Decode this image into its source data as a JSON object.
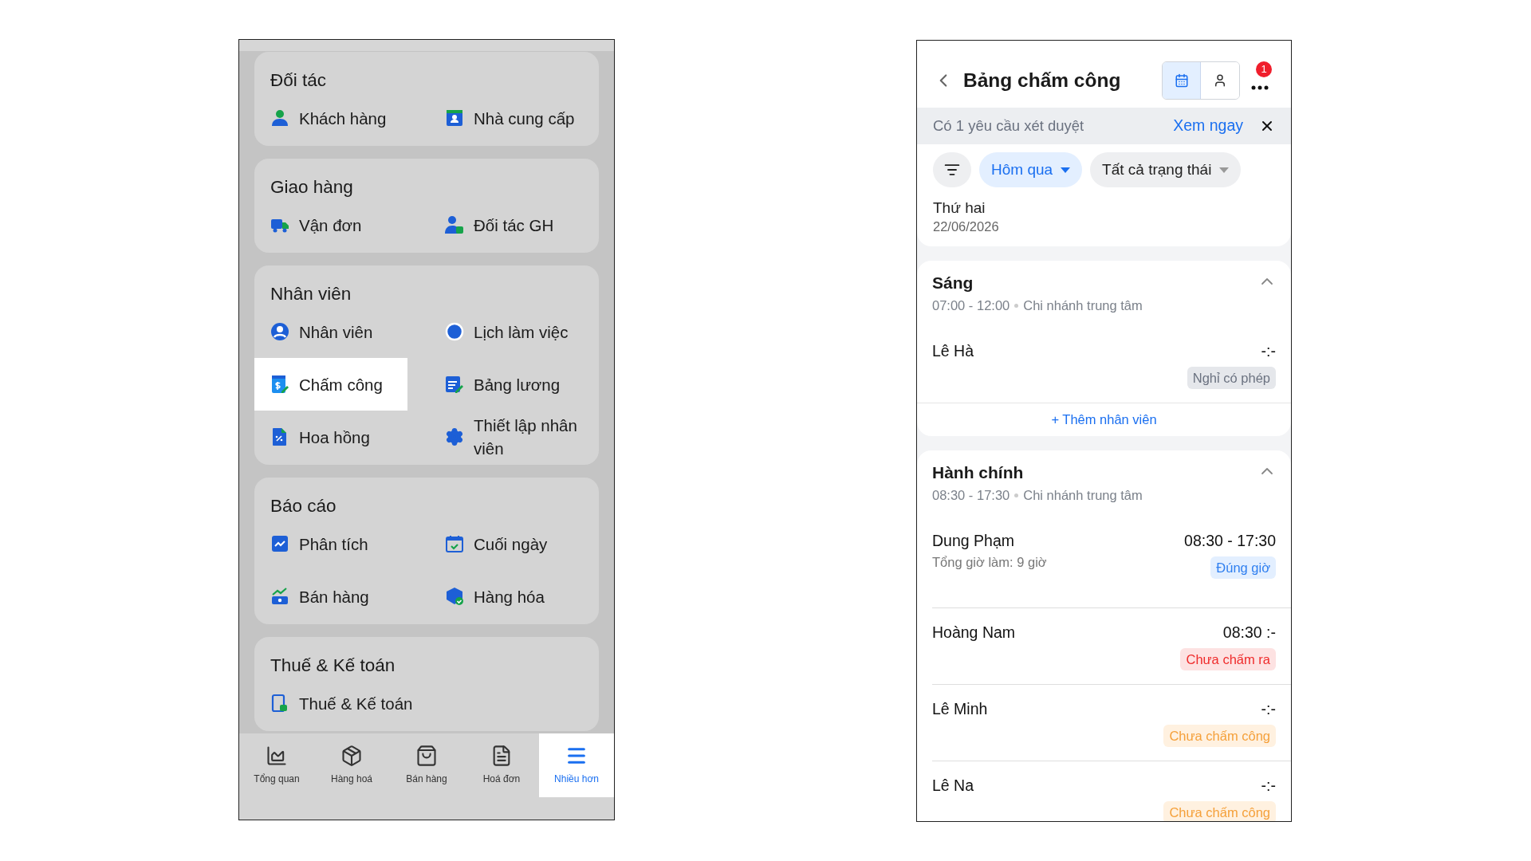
{
  "menu": {
    "sections": [
      {
        "title": "Đối tác",
        "items": [
          {
            "label": "Khách hàng",
            "selected": false
          },
          {
            "label": "Nhà cung cấp",
            "selected": false
          }
        ]
      },
      {
        "title": "Giao hàng",
        "items": [
          {
            "label": "Vận đơn",
            "selected": false
          },
          {
            "label": "Đối tác GH",
            "selected": false
          }
        ]
      },
      {
        "title": "Nhân viên",
        "items": [
          {
            "label": "Nhân viên",
            "selected": false
          },
          {
            "label": "Chấm công",
            "selected": true
          },
          {
            "label": "Hoa hồng",
            "selected": false
          },
          {
            "label": "Lịch làm việc",
            "selected": false
          },
          {
            "label": "Bảng lương",
            "selected": false
          },
          {
            "label": "Thiết lập nhân viên",
            "selected": false
          }
        ]
      },
      {
        "title": "Báo cáo",
        "items": [
          {
            "label": "Phân tích",
            "selected": false
          },
          {
            "label": "Bán hàng",
            "selected": false
          },
          {
            "label": "Cuối ngày",
            "selected": false
          },
          {
            "label": "Hàng hóa",
            "selected": false
          }
        ]
      },
      {
        "title": "Thuế & Kế toán",
        "items": [
          {
            "label": "Thuế & Kế toán",
            "selected": false
          }
        ]
      }
    ]
  },
  "bottom_nav": [
    {
      "label": "Tổng quan",
      "selected": false
    },
    {
      "label": "Hàng hoá",
      "selected": false
    },
    {
      "label": "Bán hàng",
      "selected": false
    },
    {
      "label": "Hoá đơn",
      "selected": false
    },
    {
      "label": "Nhiều hơn",
      "selected": true
    }
  ],
  "timesheet": {
    "title": "Bảng chấm công",
    "view_toggle": [
      {
        "selected": true
      },
      {
        "selected": false
      }
    ],
    "notification_count": "1",
    "banner": {
      "text": "Có 1 yêu cầu xét duyệt",
      "action": "Xem ngay"
    },
    "filters": [
      {
        "label": "Hôm qua",
        "selected": true
      },
      {
        "label": "Tất cả trạng thái",
        "selected": false
      }
    ],
    "day": {
      "weekday": "Thứ hai",
      "date": "22/06/2026"
    },
    "shifts": [
      {
        "name": "Sáng",
        "hours": "07:00 - 12:00",
        "branch": "Chi nhánh trung tâm",
        "expanded": true,
        "add_label": "+ Thêm nhân viên",
        "employees": [
          {
            "name": "Lê Hà",
            "time": "-:-",
            "status": {
              "label": "Nghỉ có phép",
              "kind": "leave"
            }
          }
        ]
      },
      {
        "name": "Hành chính",
        "hours": "08:30 - 17:30",
        "branch": "Chi nhánh trung tâm",
        "expanded": true,
        "employees": [
          {
            "name": "Dung Phạm",
            "note": "Tổng giờ làm: 9 giờ",
            "time": "08:30 - 17:30",
            "status": {
              "label": "Đúng giờ",
              "kind": "on_time"
            }
          },
          {
            "name": "Hoàng Nam",
            "time": "08:30 :-",
            "status": {
              "label": "Chưa chấm ra",
              "kind": "no_checkout"
            }
          },
          {
            "name": "Lê Minh",
            "time": "-:-",
            "status": {
              "label": "Chưa chấm công",
              "kind": "absent"
            }
          },
          {
            "name": "Lê Na",
            "time": "-:-",
            "status": {
              "label": "Chưa chấm công",
              "kind": "absent"
            }
          }
        ]
      }
    ]
  }
}
